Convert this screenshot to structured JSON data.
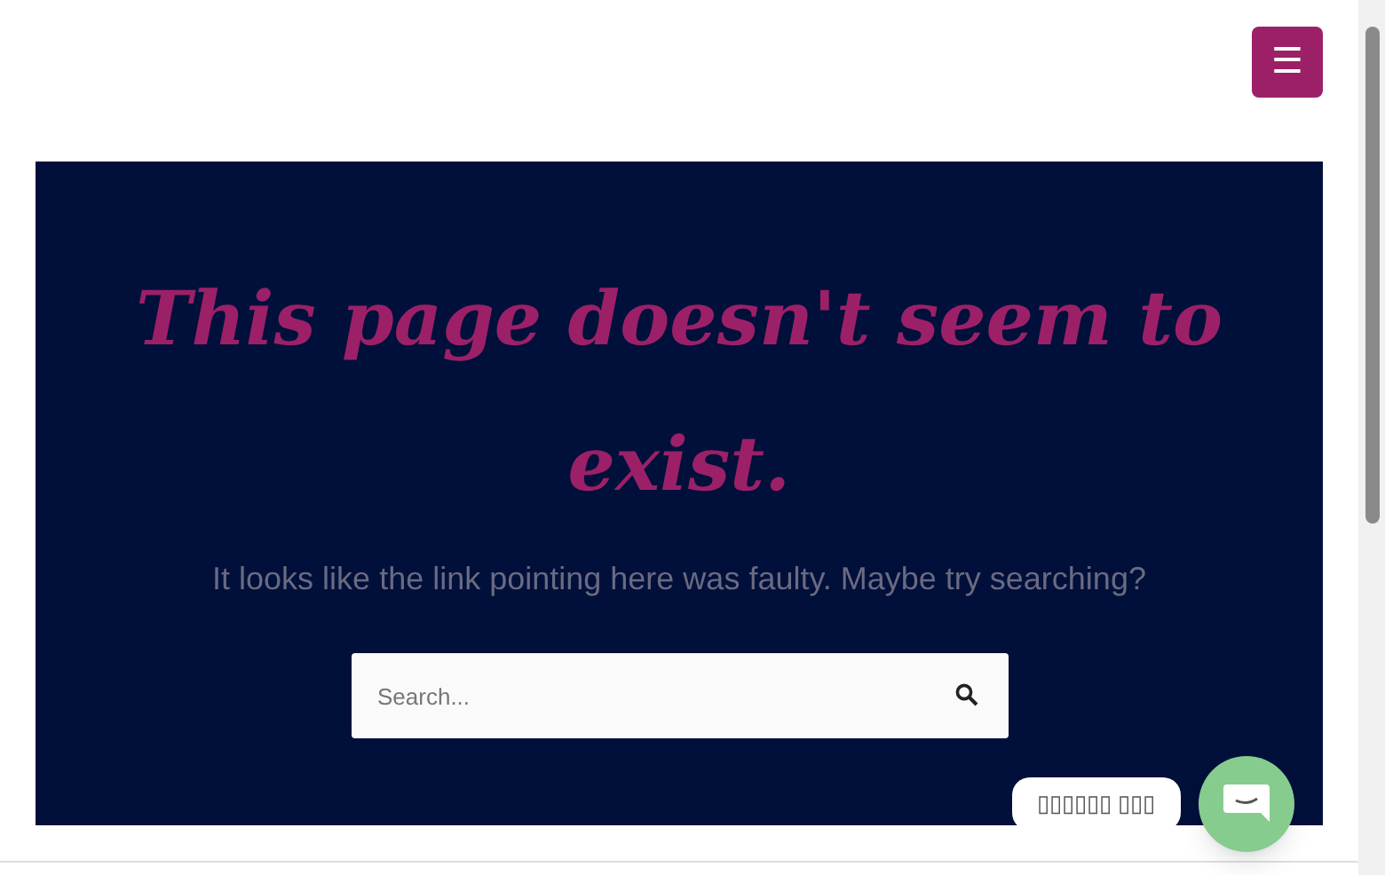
{
  "header": {
    "menu_button": "☰"
  },
  "error": {
    "title": "This page doesn't seem to exist.",
    "message": "It looks like the link pointing here was faulty. Maybe try searching?",
    "search": {
      "placeholder": "Search..."
    }
  },
  "chat_widget": {
    "label": "▯▯▯▯▯▯ ▯▯▯"
  }
}
